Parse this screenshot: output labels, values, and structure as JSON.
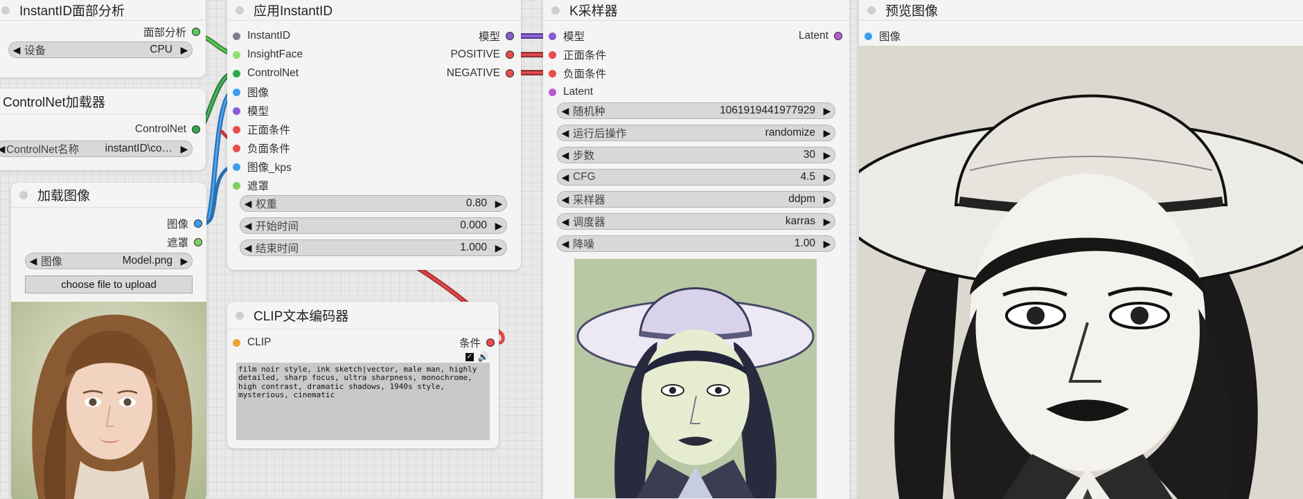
{
  "colors": {
    "image": "#3d9ef0",
    "mask": "#7fcf5c",
    "model": "#8a5bd3",
    "conditioning": "#ea4c4c",
    "latent": "#b85ad0",
    "clip": "#f0a030",
    "controlnet": "#2fa84f",
    "instantid": "#7e7e8e",
    "insightface": "#8de070"
  },
  "face_node": {
    "title": "InstantID面部分析",
    "output_face": "面部分析",
    "device_label": "设备",
    "device_value": "CPU"
  },
  "cn_node": {
    "title": "ControlNet加载器",
    "output_cn": "ControlNet",
    "name_label": "ControlNet名称",
    "name_value": "instantID\\co…"
  },
  "load_node": {
    "title": "加载图像",
    "output_image": "图像",
    "output_mask": "遮罩",
    "image_label": "图像",
    "image_value": "Model.png",
    "upload_label": "choose file to upload"
  },
  "apply_node": {
    "title": "应用InstantID",
    "inputs": [
      "InstantID",
      "InsightFace",
      "ControlNet",
      "图像",
      "模型",
      "正面条件",
      "负面条件",
      "图像_kps",
      "遮罩"
    ],
    "outputs": [
      "模型",
      "POSITIVE",
      "NEGATIVE"
    ],
    "weight_label": "权重",
    "weight_value": "0.80",
    "start_label": "开始时间",
    "start_value": "0.000",
    "end_label": "结束时间",
    "end_value": "1.000"
  },
  "clip_node": {
    "title": "CLIP文本编码器",
    "input_clip": "CLIP",
    "output_cond": "条件",
    "prompt": "film noir style, ink sketch|vector, male man, highly detailed, sharp focus, ultra sharpness, monochrome, high contrast, dramatic shadows, 1940s style, mysterious, cinematic"
  },
  "ksampler_node": {
    "title": "K采样器",
    "inputs": [
      "模型",
      "正面条件",
      "负面条件",
      "Latent"
    ],
    "output_latent": "Latent",
    "seed_label": "随机种",
    "seed_value": "1061919441977929",
    "control_label": "运行后操作",
    "control_value": "randomize",
    "steps_label": "步数",
    "steps_value": "30",
    "cfg_label": "CFG",
    "cfg_value": "4.5",
    "sampler_label": "采样器",
    "sampler_value": "ddpm",
    "scheduler_label": "调度器",
    "scheduler_value": "karras",
    "denoise_label": "降噪",
    "denoise_value": "1.00"
  },
  "preview_node": {
    "title": "预览图像",
    "input_image": "图像"
  }
}
